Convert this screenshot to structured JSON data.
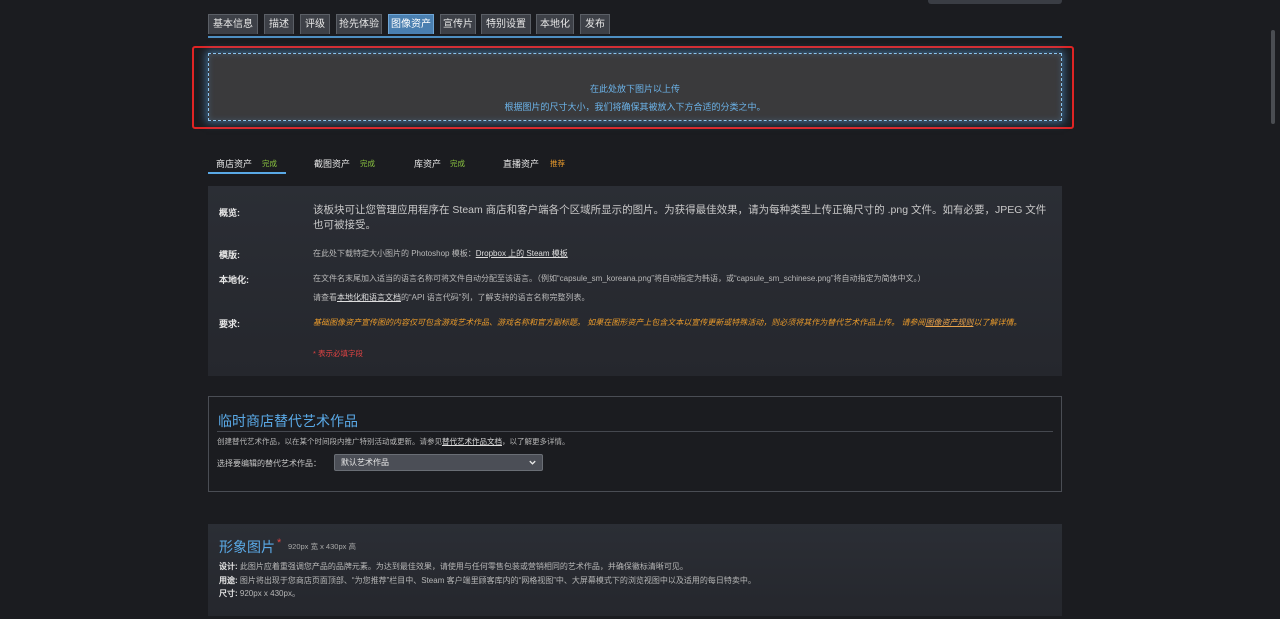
{
  "tabs": [
    "基本信息",
    "描述",
    "评级",
    "抢先体验",
    "图像资产",
    "宣传片",
    "特别设置",
    "本地化",
    "发布"
  ],
  "active_tab": "图像资产",
  "dropzone": {
    "line1": "在此处放下图片以上传",
    "line2": "根据图片的尺寸大小，我们将确保其被放入下方合适的分类之中。"
  },
  "subtabs": [
    {
      "label": "商店资产",
      "badge": "完成",
      "status": "ok"
    },
    {
      "label": "截图资产",
      "badge": "完成",
      "status": "ok"
    },
    {
      "label": "库资产",
      "badge": "完成",
      "status": "ok"
    },
    {
      "label": "直播资产",
      "badge": "推荐",
      "status": "recommended"
    }
  ],
  "info": {
    "overview_label": "概览:",
    "overview_text": "该板块可让您管理应用程序在 Steam 商店和客户端各个区域所显示的图片。为获得最佳效果，请为每种类型上传正确尺寸的 .png 文件。如有必要，JPEG 文件也可被接受。",
    "template_label": "模版:",
    "template_text": "在此处下载特定大小图片的 Photoshop 模板：",
    "template_link": "Dropbox 上的 Steam 模板",
    "localization_label": "本地化:",
    "localization_text1": "在文件名末尾加入适当的语言名称可将文件自动分配至该语言。（例如“capsule_sm_koreana.png”将自动指定为韩语，或“capsule_sm_schinese.png”将自动指定为简体中文。）",
    "localization_text2_pre": "请查看",
    "localization_text2_link": "本地化和语言文档",
    "localization_text2_post": "的“API 语言代码”列，了解支持的语言名称完整列表。",
    "requirements_label": "要求:",
    "requirements_text": "基础图像资产宣传图的内容仅可包含游戏艺术作品、游戏名称和官方副标题。 如果在图形资产上包含文本以宣传更新或特殊活动，则必须将其作为替代艺术作品上传。 请参阅",
    "requirements_link": "图像资产规则",
    "requirements_post": "以了解详情。",
    "required_note": "* 表示必填字段"
  },
  "alt": {
    "title": "临时商店替代艺术作品",
    "desc_pre": "创建替代艺术作品，以在某个时间段内推广特别活动或更新。请参见",
    "desc_link": "替代艺术作品文档",
    "desc_post": "，以了解更多详情。",
    "select_label": "选择要编辑的替代艺术作品：",
    "select_value": "默认艺术作品"
  },
  "hero": {
    "title": "形象图片",
    "required_mark": "*",
    "size": "920px 宽 x 430px 高",
    "design_label": "设计:",
    "design_text": "此图片应着重强调您产品的品牌元素。为达到最佳效果，请使用与任何零售包装或营销相同的艺术作品，并确保徽标清晰可见。",
    "usage_label": "用途:",
    "usage_text": "图片将出现于您商店页面顶部、“为您推荐”栏目中、Steam 客户端里顾客库内的“网格视图”中、大屏幕模式下的浏览视图中以及适用的每日特卖中。",
    "dim_label": "尺寸:",
    "dim_text": "920px x 430px。"
  },
  "colors": {
    "accent": "#5aa9e6",
    "done": "#8bc53f",
    "recommended": "#e89a2b",
    "required": "#e04343",
    "highlight_border": "#e02424"
  }
}
